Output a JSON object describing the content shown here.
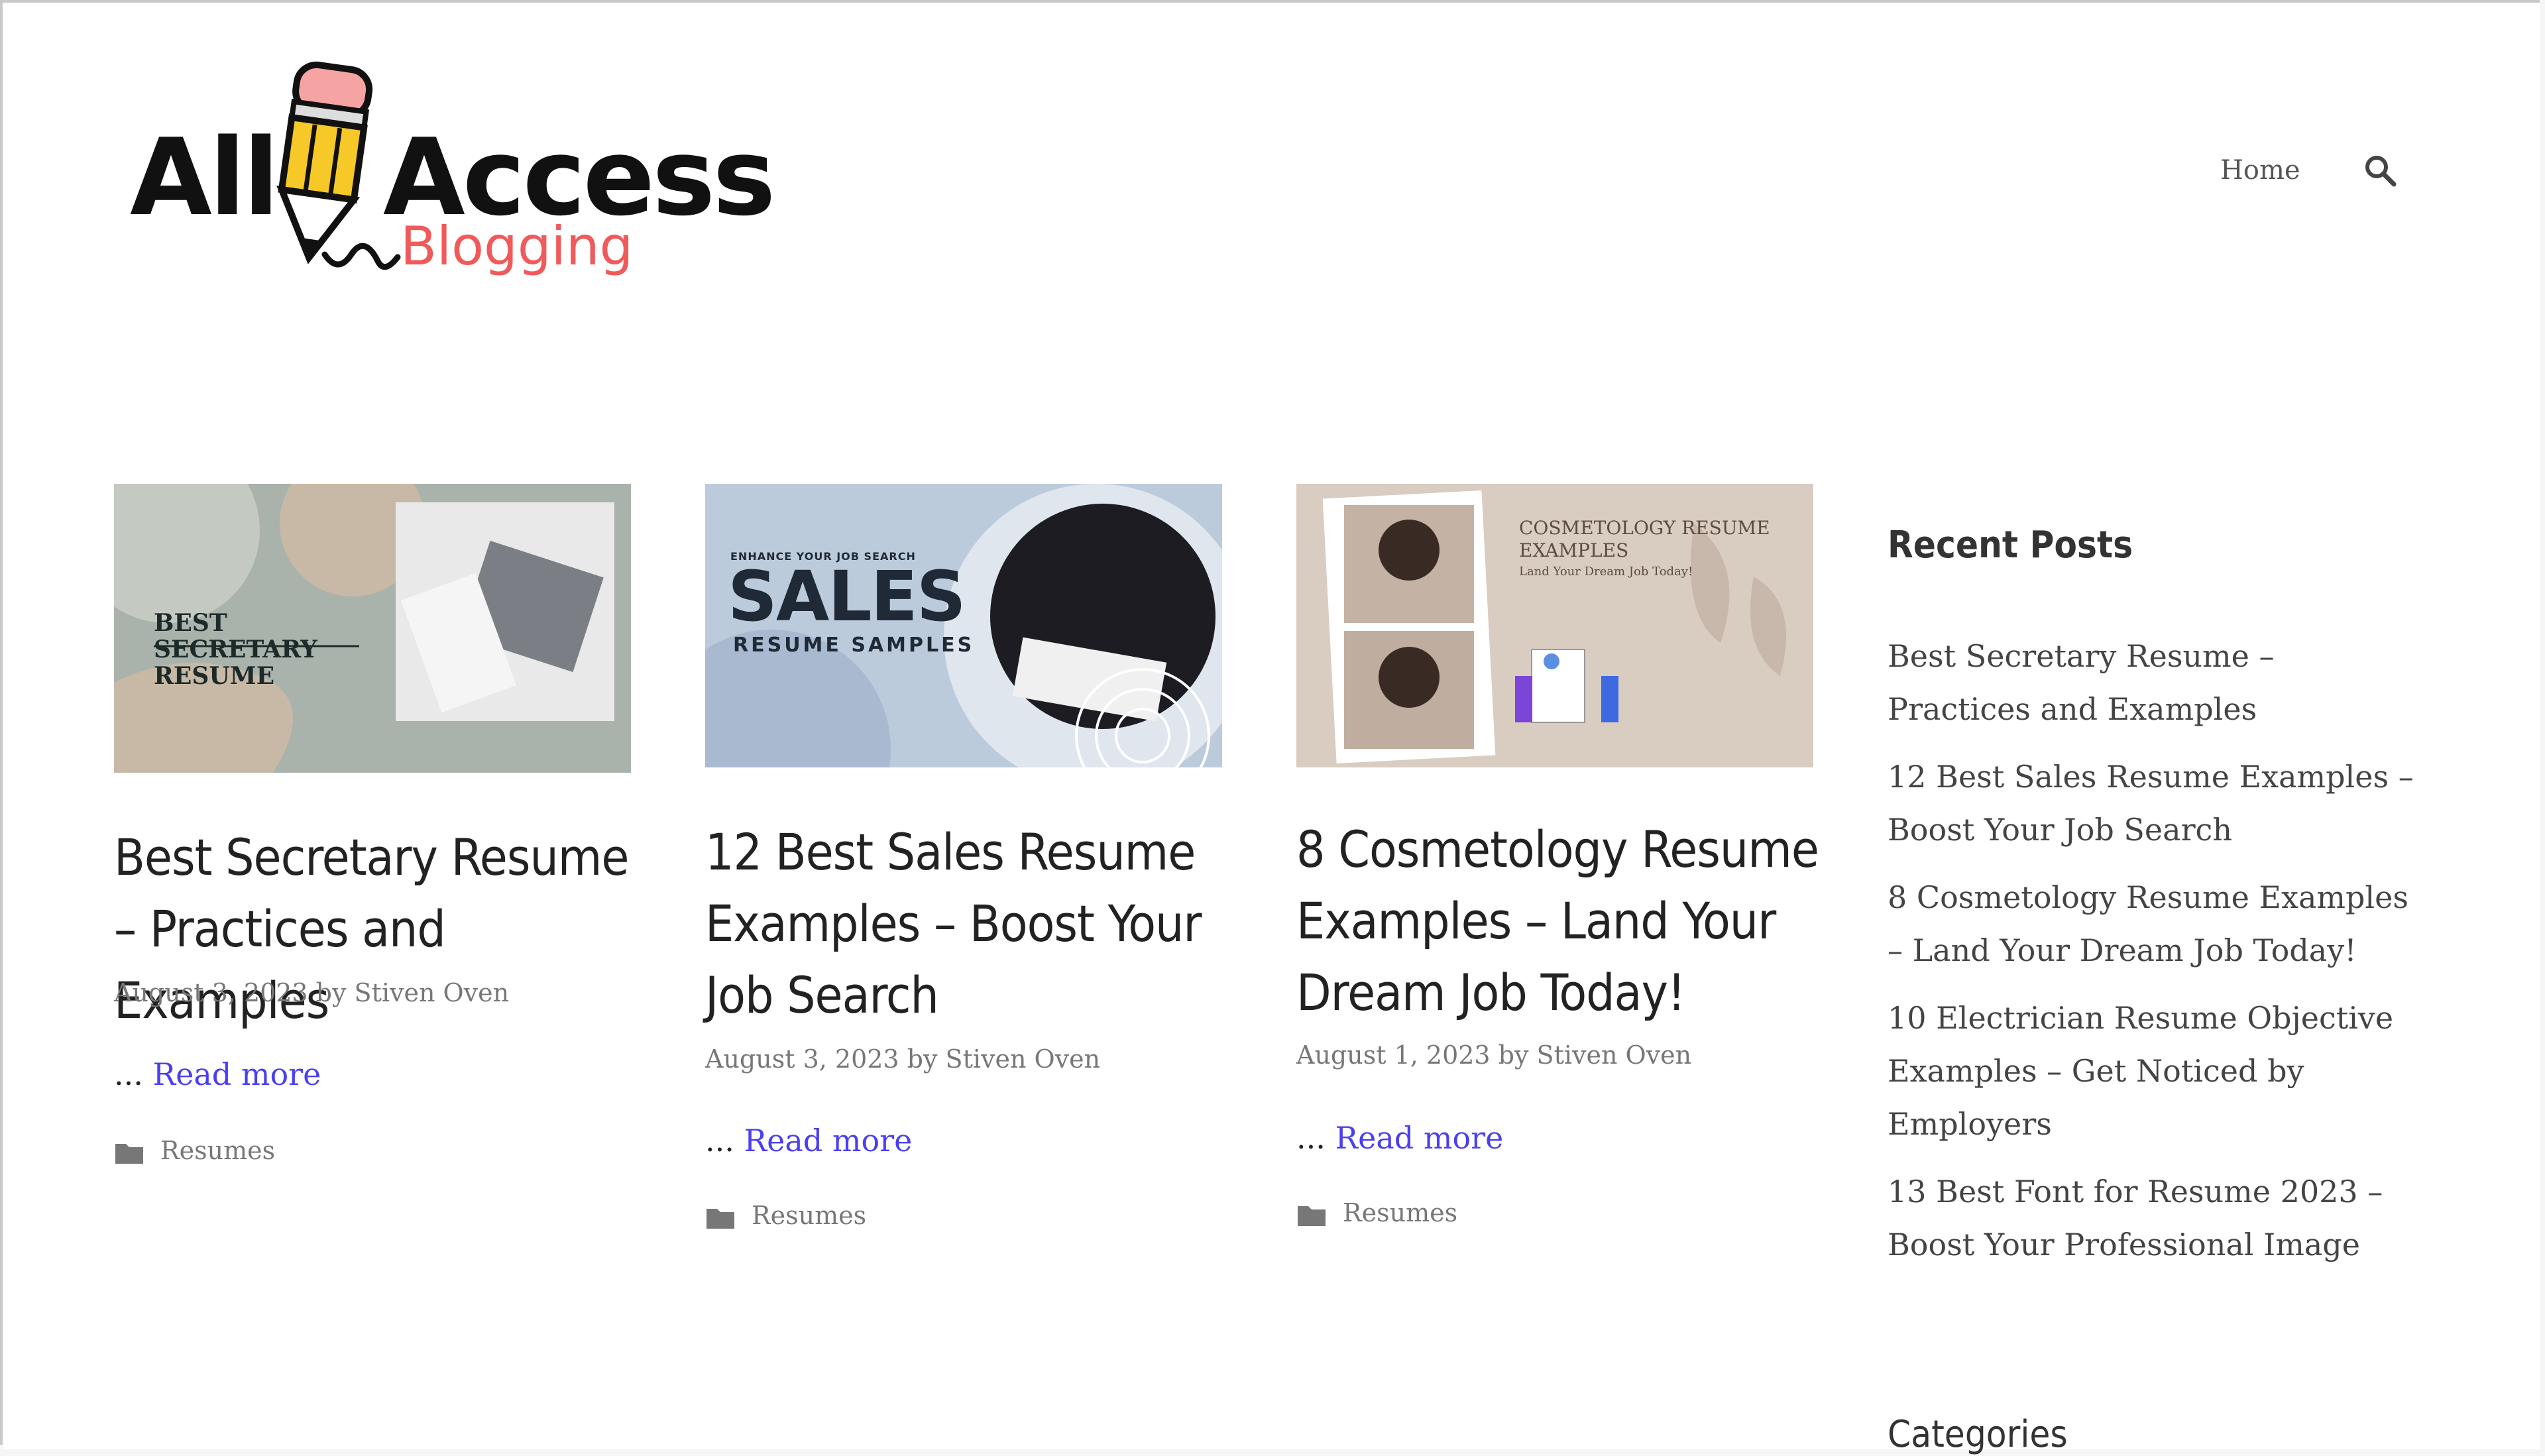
{
  "site": {
    "logo_line1": "All",
    "logo_line1b": "Access",
    "logo_line2": "Blogging",
    "brand_red": "#f05a5a",
    "link_color": "#4a3ff0"
  },
  "nav": {
    "home_label": "Home",
    "search_icon": "search-icon"
  },
  "posts": [
    {
      "thumb_text": "BEST SECRETARY RESUME",
      "title": "Best Secretary Resume – Practices and Examples",
      "meta": "August 3, 2023 by Stiven Oven",
      "ellipsis": "...",
      "read_more": "Read more",
      "category": "Resumes"
    },
    {
      "thumb_kicker": "ENHANCE YOUR JOB SEARCH",
      "thumb_text": "SALES",
      "thumb_sub": "RESUME SAMPLES",
      "title": "12 Best Sales Resume Examples – Boost Your Job Search",
      "meta": "August 3, 2023 by Stiven Oven",
      "ellipsis": "...",
      "read_more": "Read more",
      "category": "Resumes"
    },
    {
      "thumb_text": "COSMETOLOGY RESUME EXAMPLES",
      "thumb_sub": "Land Your Dream Job Today!",
      "title": "8 Cosmetology Resume Examples – Land Your Dream Job Today!",
      "meta": "August 1, 2023 by Stiven Oven",
      "ellipsis": "...",
      "read_more": "Read more",
      "category": "Resumes"
    }
  ],
  "sidebar": {
    "recent_heading": "Recent Posts",
    "recent": [
      "Best Secretary Resume – Practices and Examples",
      "12 Best Sales Resume Examples – Boost Your Job Search",
      "8 Cosmetology Resume Examples – Land Your Dream Job Today!",
      "10 Electrician Resume Objective Examples – Get Noticed by Employers",
      "13 Best Font for Resume 2023 – Boost Your Professional Image"
    ],
    "categories_heading": "Categories"
  }
}
